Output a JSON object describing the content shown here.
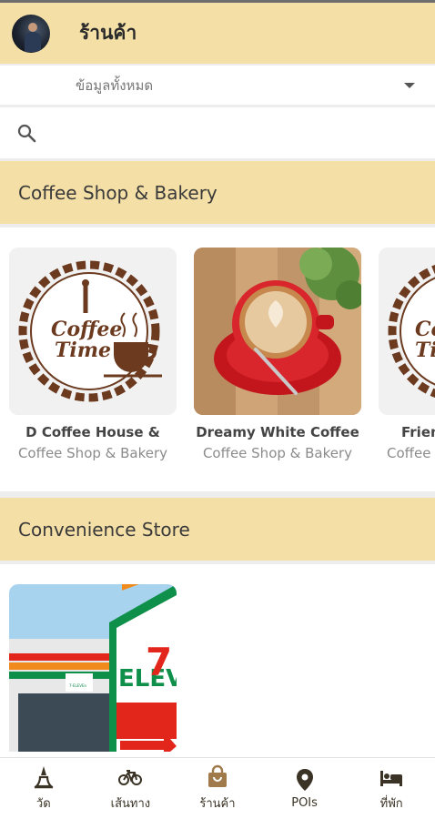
{
  "app": {
    "title": "ร้านค้า"
  },
  "filter": {
    "selected": "ข้อมูลทั้งหมด"
  },
  "search": {
    "placeholder": "",
    "value": ""
  },
  "sections": [
    {
      "title": "Coffee Shop & Bakery",
      "cards": [
        {
          "name": "D Coffee House &",
          "category": "Coffee Shop & Bakery",
          "logo_text": [
            "Coffee",
            "Time"
          ]
        },
        {
          "name": "Dreamy White Coffee",
          "category": "Coffee Shop & Bakery"
        },
        {
          "name": "Frien",
          "category": "Coffee",
          "logo_text": [
            "Co",
            "Ti"
          ]
        }
      ]
    },
    {
      "title": "Convenience Store",
      "cards": [
        {
          "sign_text": "ELEV",
          "sign_number": "7",
          "storefront_text": "7-ELEVEn"
        }
      ]
    }
  ],
  "bottom_nav": [
    {
      "label": "วัด",
      "icon": "temple-icon"
    },
    {
      "label": "เส้นทาง",
      "icon": "bicycle-icon"
    },
    {
      "label": "ร้านค้า",
      "icon": "shopping-bag-icon"
    },
    {
      "label": "POIs",
      "icon": "location-pin-icon"
    },
    {
      "label": "ที่พัก",
      "icon": "bed-icon"
    }
  ],
  "colors": {
    "header_bg": "#f4dfa6",
    "accent_brown": "#6b3a1f",
    "nav_icon": "#3b3426"
  }
}
